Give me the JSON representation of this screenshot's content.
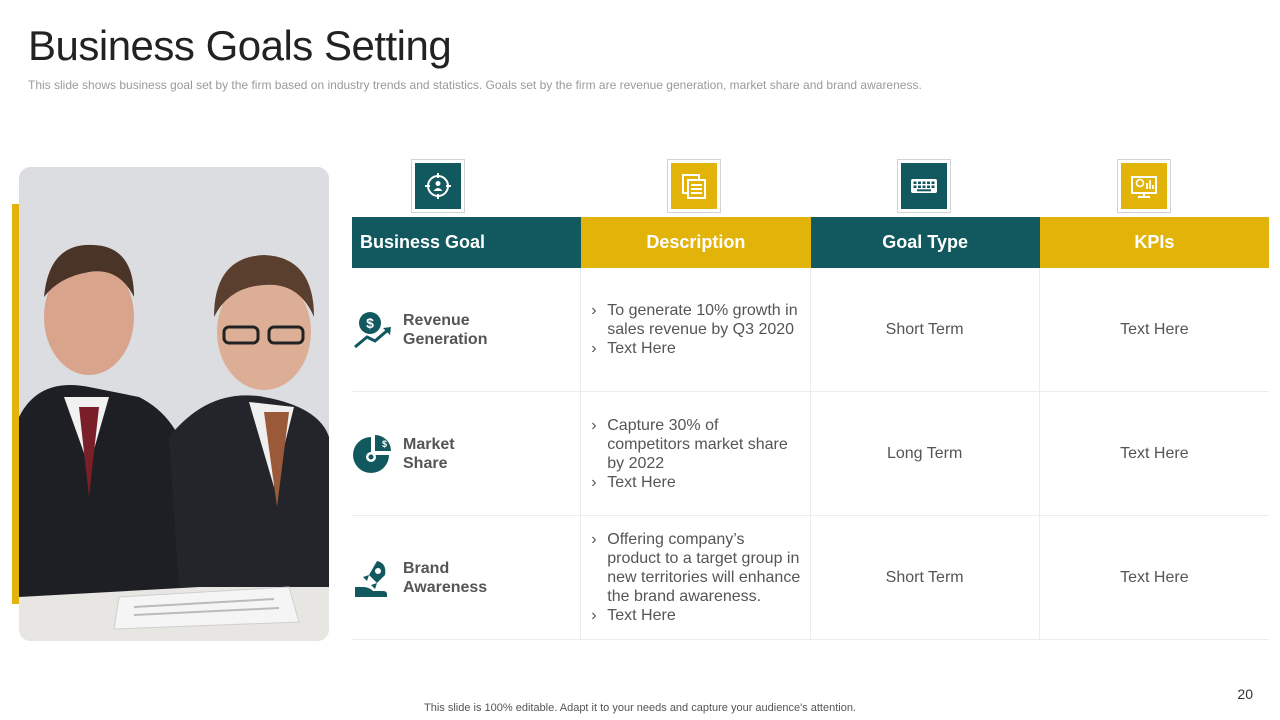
{
  "slide": {
    "title": "Business Goals Setting",
    "subtitle": "This slide shows business goal set by the firm based on industry trends and statistics. Goals set by the firm are revenue  generation,  market share and brand awareness.",
    "footer": "This slide is 100% editable. Adapt it to your needs and capture your audience's attention.",
    "page_number": "20"
  },
  "colors": {
    "teal": "#11585f",
    "gold": "#e2b40a"
  },
  "header_icons": [
    "target-user-icon",
    "documents-icon",
    "keyboard-icon",
    "dashboard-monitor-icon"
  ],
  "table": {
    "headers": [
      "Business Goal",
      "Description",
      "Goal Type",
      "KPIs"
    ],
    "rows": [
      {
        "icon": "revenue-growth-icon",
        "goal": "Revenue\nGeneration",
        "description": [
          "To generate 10% growth in sales revenue  by Q3 2020",
          "Text Here"
        ],
        "goal_type": "Short Term",
        "kpis": "Text Here"
      },
      {
        "icon": "market-share-pie-icon",
        "goal": "Market\nShare",
        "description": [
          "Capture 30% of competitors market share by 2022",
          "Text Here"
        ],
        "goal_type": "Long Term",
        "kpis": "Text Here"
      },
      {
        "icon": "rocket-hand-icon",
        "goal": "Brand\nAwareness",
        "description": [
          "Offering company’s product to a target group  in new territories will enhance the brand awareness.",
          "Text Here"
        ],
        "goal_type": "Short Term",
        "kpis": "Text Here"
      }
    ]
  }
}
